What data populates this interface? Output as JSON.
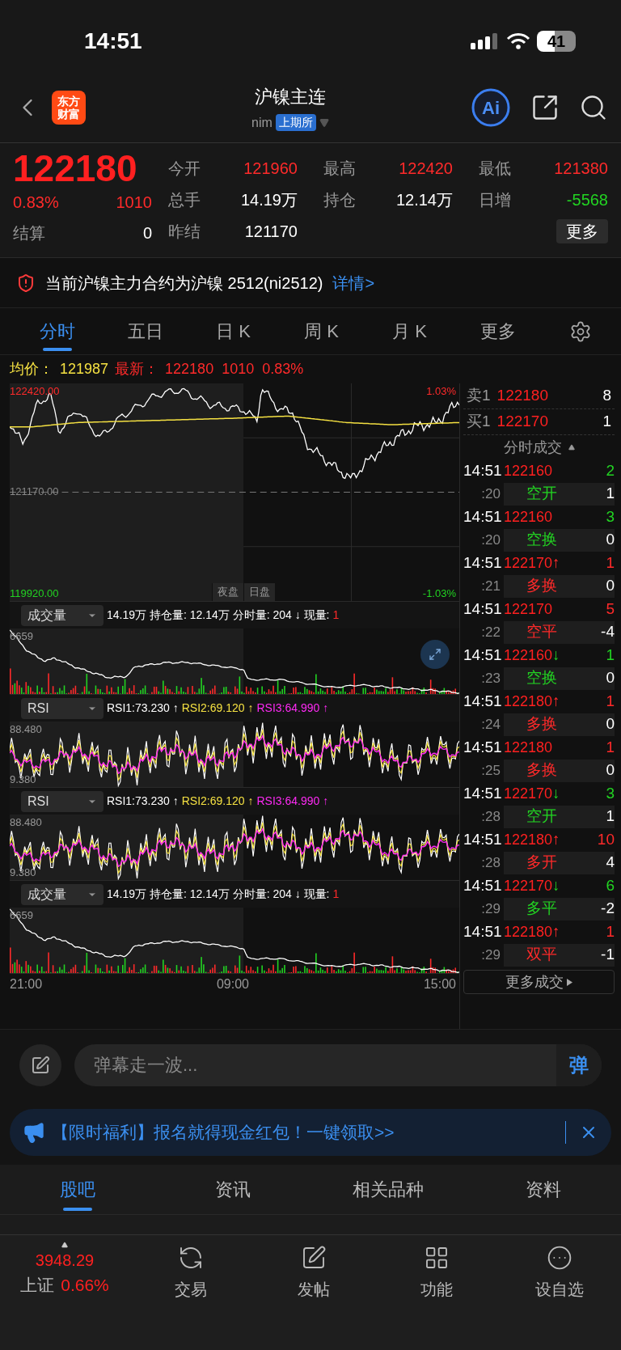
{
  "status_bar": {
    "time": "14:51",
    "battery": "41"
  },
  "nav": {
    "logo": "东方财富",
    "title": "沪镍主连",
    "code": "nim",
    "exchange": "上期所",
    "ai_label": "Ai"
  },
  "quote": {
    "price": "122180",
    "change_pct": "0.83%",
    "change": "1010",
    "settle_label": "结算",
    "settle": "0",
    "fields": [
      {
        "label": "今开",
        "value": "121960",
        "color": "#ff2a2a"
      },
      {
        "label": "最高",
        "value": "122420",
        "color": "#ff2a2a"
      },
      {
        "label": "最低",
        "value": "121380",
        "color": "#ff2a2a"
      },
      {
        "label": "总手",
        "value": "14.19万",
        "color": "#ffffff"
      },
      {
        "label": "持仓",
        "value": "12.14万",
        "color": "#ffffff"
      },
      {
        "label": "日增",
        "value": "-5568",
        "color": "#22d322"
      },
      {
        "label": "昨结",
        "value": "121170",
        "color": "#ffffff"
      }
    ],
    "more_button": "更多"
  },
  "notice": {
    "text": "当前沪镍主力合约为沪镍 2512(ni2512)",
    "link": "详情>"
  },
  "tabs": [
    {
      "label": "分时",
      "selected": true
    },
    {
      "label": "五日",
      "selected": false
    },
    {
      "label": "日 K",
      "selected": false
    },
    {
      "label": "周 K",
      "selected": false
    },
    {
      "label": "月 K",
      "selected": false
    },
    {
      "label": "更多",
      "selected": false
    }
  ],
  "summary": [
    {
      "text": "均价：",
      "color": "#f5e142"
    },
    {
      "text": "121987",
      "color": "#f5e142"
    },
    {
      "text": "最新：",
      "color": "#ff2a2a"
    },
    {
      "text": "122180  1010  0.83%",
      "color": "#ff2a2a"
    }
  ],
  "price_chart": {
    "high": "122420.00",
    "high_pct": "1.03%",
    "mid": "121170.00",
    "low": "119920.00",
    "low_pct": "-1.03%",
    "sessions": [
      "夜盘",
      "日盘"
    ]
  },
  "panels": [
    {
      "kind": "volume",
      "selector": "成交量",
      "max": "6659",
      "stats": [
        {
          "text": "14.19万 持仓量: 12.14万 分时量: 204 ↓ 现量:",
          "color": "#ffffff"
        },
        {
          "text": "1",
          "color": "#ff2a2a"
        }
      ]
    },
    {
      "kind": "rsi",
      "selector": "RSI",
      "max": "88.480",
      "min": "9.380",
      "stats": [
        {
          "text": "RSI1:73.230 ↑",
          "color": "#ffffff"
        },
        {
          "text": "RSI2:69.120 ↑",
          "color": "#f5e142"
        },
        {
          "text": "RSI3:64.990 ↑",
          "color": "#ff2af5"
        }
      ]
    },
    {
      "kind": "rsi",
      "selector": "RSI",
      "max": "88.480",
      "min": "9.380",
      "stats": [
        {
          "text": "RSI1:73.230 ↑",
          "color": "#ffffff"
        },
        {
          "text": "RSI2:69.120 ↑",
          "color": "#f5e142"
        },
        {
          "text": "RSI3:64.990 ↑",
          "color": "#ff2af5"
        }
      ]
    },
    {
      "kind": "volume",
      "selector": "成交量",
      "max": "6659",
      "stats": [
        {
          "text": "14.19万 持仓量: 12.14万 分时量: 204 ↓ 现量:",
          "color": "#ffffff"
        },
        {
          "text": "1",
          "color": "#ff2a2a"
        }
      ]
    }
  ],
  "x_labels": [
    "21:00",
    "09:00",
    "15:00"
  ],
  "order_book": [
    {
      "label": "卖1",
      "price": "122180",
      "volume": "8"
    },
    {
      "label": "买1",
      "price": "122170",
      "volume": "1"
    }
  ],
  "trades_title": "分时成交",
  "trades": [
    {
      "time": "14:51",
      "price": "122160",
      "volume": "2",
      "color": "#22d322",
      "second": ":20",
      "type": "空开",
      "change": "1"
    },
    {
      "time": "14:51",
      "price": "122160",
      "volume": "3",
      "color": "#22d322",
      "second": ":20",
      "type": "空换",
      "change": "0"
    },
    {
      "time": "14:51",
      "price": "122170",
      "arrow": "↑",
      "volume": "1",
      "color": "#ff2a2a",
      "second": ":21",
      "type": "多换",
      "change": "0"
    },
    {
      "time": "14:51",
      "price": "122170",
      "volume": "5",
      "color": "#ff2a2a",
      "second": ":22",
      "type": "空平",
      "change": "-4"
    },
    {
      "time": "14:51",
      "price": "122160",
      "arrow": "↓",
      "volume": "1",
      "color": "#22d322",
      "second": ":23",
      "type": "空换",
      "change": "0"
    },
    {
      "time": "14:51",
      "price": "122180",
      "arrow": "↑",
      "volume": "1",
      "color": "#ff2a2a",
      "second": ":24",
      "type": "多换",
      "change": "0"
    },
    {
      "time": "14:51",
      "price": "122180",
      "volume": "1",
      "color": "#ff2a2a",
      "second": ":25",
      "type": "多换",
      "change": "0"
    },
    {
      "time": "14:51",
      "price": "122170",
      "arrow": "↓",
      "volume": "3",
      "color": "#22d322",
      "second": ":28",
      "type": "空开",
      "change": "1"
    },
    {
      "time": "14:51",
      "price": "122180",
      "arrow": "↑",
      "volume": "10",
      "color": "#ff2a2a",
      "second": ":28",
      "type": "多开",
      "change": "4"
    },
    {
      "time": "14:51",
      "price": "122170",
      "arrow": "↓",
      "volume": "6",
      "color": "#22d322",
      "second": ":29",
      "type": "多平",
      "change": "-2"
    },
    {
      "time": "14:51",
      "price": "122180",
      "arrow": "↑",
      "volume": "1",
      "color": "#ff2a2a",
      "second": ":29",
      "type": "双平",
      "change": "-1"
    }
  ],
  "more_trades": "更多成交",
  "comment": {
    "placeholder": "弹幕走一波...",
    "send": "弹"
  },
  "banner": {
    "text": "【限时福利】报名就得现金红包！一键领取>>"
  },
  "bottom_tabs": [
    {
      "label": "股吧",
      "selected": true
    },
    {
      "label": "资讯",
      "selected": false
    },
    {
      "label": "相关品种",
      "selected": false
    },
    {
      "label": "资料",
      "selected": false
    }
  ],
  "index": {
    "value": "3948.29",
    "name": "上证",
    "pct": "0.66%"
  },
  "toolbar": [
    "交易",
    "发帖",
    "功能",
    "设自选"
  ]
}
